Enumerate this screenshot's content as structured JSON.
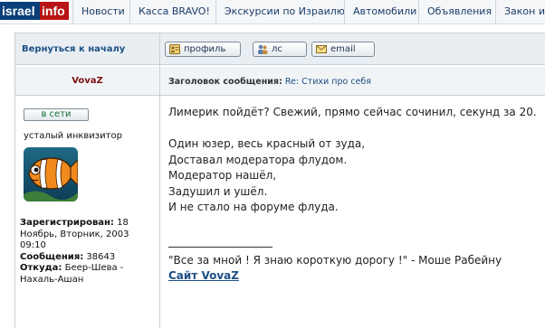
{
  "nav": {
    "logo_part1": "israel",
    "logo_part2": "info",
    "items": [
      "Новости",
      "Касса BRAVO!",
      "Экскурсии по Израилю",
      "Автомобили",
      "Объявления",
      "Закон и"
    ]
  },
  "post": {
    "back_link": "Вернуться к началу",
    "buttons": {
      "profile": "профиль",
      "pm": "лс",
      "email": "email"
    },
    "author": "VovaZ",
    "subject_label": "Заголовок сообщения:",
    "subject_value": "Re: Стихи про себя",
    "status": "в сети",
    "rank": "усталый инквизитор",
    "stats": {
      "registered_label": "Зарегистрирован:",
      "registered_value": "18 Ноябрь, Вторник, 2003 09:10",
      "messages_label": "Сообщения:",
      "messages_value": "38643",
      "from_label": "Откуда:",
      "from_value": "Беер-Шева - Нахаль-Ашан"
    },
    "body_intro": "Лимерик пойдёт? Свежий, прямо сейчас сочинил, секунд за 20.",
    "body_lines": [
      "Один юзер, весь красный от зуда,",
      "Доставал модератора флудом.",
      "Модератор нашёл,",
      "Задушил и ушёл.",
      "И не стало на форуме флуда."
    ],
    "signature_quote": "\"Все за мной ! Я знаю короткую дорогу !\" - Моше Рабейну",
    "signature_link": "Сайт VovaZ"
  }
}
